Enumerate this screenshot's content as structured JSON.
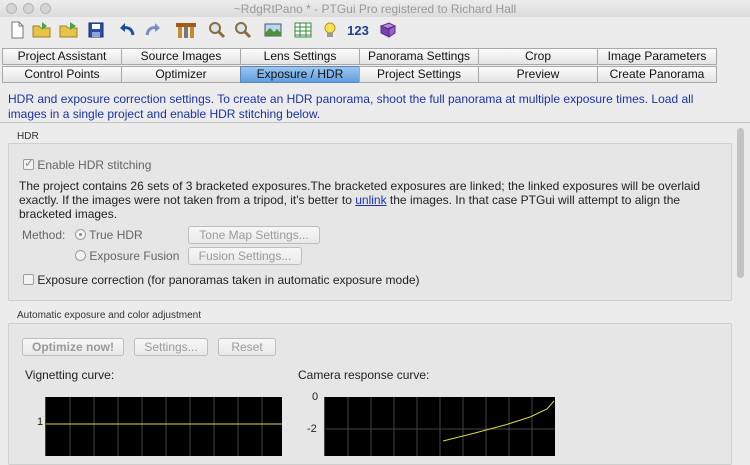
{
  "window": {
    "title": "~RdgRtPano * - PTGui Pro registered to Richard Hall"
  },
  "toolbar": {
    "count_label": "123"
  },
  "tabs_row1": [
    "Project Assistant",
    "Source Images",
    "Lens Settings",
    "Panorama Settings",
    "Crop",
    "Image Parameters"
  ],
  "tabs_row2": [
    "Control Points",
    "Optimizer",
    "Exposure / HDR",
    "Project Settings",
    "Preview",
    "Create Panorama"
  ],
  "active_tab": "Exposure / HDR",
  "description": "HDR and exposure correction settings. To create an HDR panorama, shoot the full panorama at multiple exposure times. Load all images in a single project and enable HDR stitching below.",
  "hdr": {
    "group_label": "HDR",
    "enable_label": "Enable HDR stitching",
    "info_before_link": "The project contains 26 sets of 3 bracketed exposures.The bracketed exposures are linked; the linked exposures will be overlaid exactly. If the images were not taken from a tripod, it's better to ",
    "info_link": "unlink",
    "info_after_link": " the images. In that case PTGui will attempt to align the bracketed images.",
    "method_label": "Method:",
    "option_true_hdr": "True HDR",
    "option_fusion": "Exposure Fusion",
    "tone_map_button": "Tone Map Settings...",
    "fusion_button": "Fusion Settings...",
    "exposure_correction_label": "Exposure correction (for panoramas taken in automatic exposure mode)"
  },
  "auto": {
    "group_label": "Automatic exposure and color adjustment",
    "optimize_button": "Optimize now!",
    "settings_button": "Settings...",
    "reset_button": "Reset",
    "vignetting_label": "Vignetting curve:",
    "response_label": "Camera response curve:",
    "vignetting_tick": "1",
    "response_ticks": [
      "0",
      "-2"
    ]
  }
}
